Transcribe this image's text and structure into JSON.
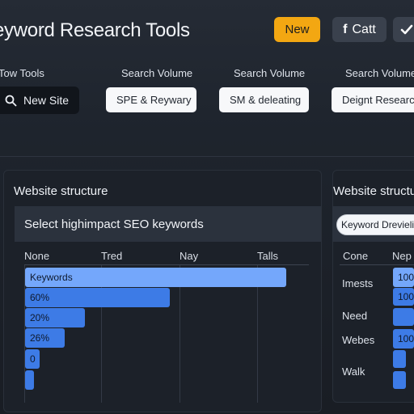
{
  "header": {
    "title": "eyword Research Tools",
    "new_label": "New",
    "cat_label": "Catt",
    "fb_icon": "facebook-icon",
    "check_icon": "check-icon"
  },
  "toolbar": {
    "columns": [
      "Tow Tools",
      "Search Volume",
      "Search Volume",
      "Search Volume"
    ],
    "search_label": "New Site",
    "pills": [
      "SPE & Reywary",
      "SM & deleating",
      "Deignt Research"
    ]
  },
  "panel_left": {
    "title": "Website structure",
    "subheader": "Select highimpact SEO keywords",
    "headers": [
      "None",
      "Tred",
      "Nay",
      "Talls"
    ],
    "rows": [
      {
        "label": "Keywords",
        "fill": 0.92
      },
      {
        "label": "60%",
        "fill": 0.51
      },
      {
        "label": "20%",
        "fill": 0.21
      },
      {
        "label": "26%",
        "fill": 0.14
      },
      {
        "label": "0",
        "fill": 0.05
      },
      {
        "label": "",
        "fill": 0.03
      }
    ]
  },
  "panel_right": {
    "title": "Website structu",
    "tab_label": "Keyword Drevieli",
    "headers": [
      "Cone",
      "Nep"
    ],
    "rows": [
      {
        "label": "Imests",
        "value": "100"
      },
      {
        "label": "Need",
        "value": "100"
      },
      {
        "label": "Webes",
        "value": "100"
      },
      {
        "label": "Walk",
        "value": ""
      }
    ]
  },
  "colors": {
    "accent": "#f3a712",
    "bar_light": "#74a7fb",
    "bar_main": "#3d7be6",
    "background": "#1e242d"
  }
}
